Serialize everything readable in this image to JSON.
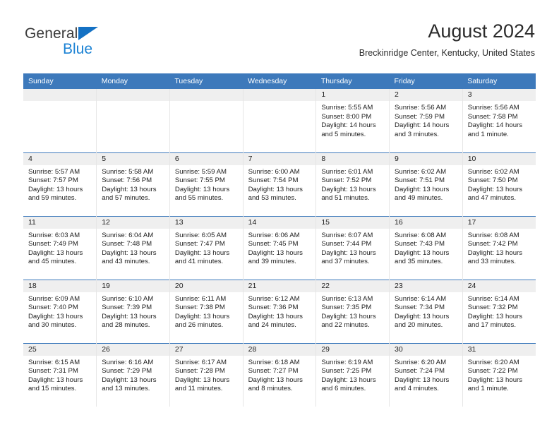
{
  "brand": {
    "name_part1": "General",
    "name_part2": "Blue",
    "triangle_color": "#1471c4",
    "blue_color": "#1b82d4"
  },
  "header": {
    "title": "August 2024",
    "subtitle": "Breckinridge Center, Kentucky, United States"
  },
  "theme": {
    "header_blue": "#3d79bb",
    "daynum_band": "#efefef",
    "text": "#1e1e1e"
  },
  "weekdays": [
    "Sunday",
    "Monday",
    "Tuesday",
    "Wednesday",
    "Thursday",
    "Friday",
    "Saturday"
  ],
  "weeks": [
    [
      {
        "day": "",
        "empty": true
      },
      {
        "day": "",
        "empty": true
      },
      {
        "day": "",
        "empty": true
      },
      {
        "day": "",
        "empty": true
      },
      {
        "day": "1",
        "sunrise": "Sunrise: 5:55 AM",
        "sunset": "Sunset: 8:00 PM",
        "daylight1": "Daylight: 14 hours",
        "daylight2": "and 5 minutes."
      },
      {
        "day": "2",
        "sunrise": "Sunrise: 5:56 AM",
        "sunset": "Sunset: 7:59 PM",
        "daylight1": "Daylight: 14 hours",
        "daylight2": "and 3 minutes."
      },
      {
        "day": "3",
        "sunrise": "Sunrise: 5:56 AM",
        "sunset": "Sunset: 7:58 PM",
        "daylight1": "Daylight: 14 hours",
        "daylight2": "and 1 minute."
      }
    ],
    [
      {
        "day": "4",
        "sunrise": "Sunrise: 5:57 AM",
        "sunset": "Sunset: 7:57 PM",
        "daylight1": "Daylight: 13 hours",
        "daylight2": "and 59 minutes."
      },
      {
        "day": "5",
        "sunrise": "Sunrise: 5:58 AM",
        "sunset": "Sunset: 7:56 PM",
        "daylight1": "Daylight: 13 hours",
        "daylight2": "and 57 minutes."
      },
      {
        "day": "6",
        "sunrise": "Sunrise: 5:59 AM",
        "sunset": "Sunset: 7:55 PM",
        "daylight1": "Daylight: 13 hours",
        "daylight2": "and 55 minutes."
      },
      {
        "day": "7",
        "sunrise": "Sunrise: 6:00 AM",
        "sunset": "Sunset: 7:54 PM",
        "daylight1": "Daylight: 13 hours",
        "daylight2": "and 53 minutes."
      },
      {
        "day": "8",
        "sunrise": "Sunrise: 6:01 AM",
        "sunset": "Sunset: 7:52 PM",
        "daylight1": "Daylight: 13 hours",
        "daylight2": "and 51 minutes."
      },
      {
        "day": "9",
        "sunrise": "Sunrise: 6:02 AM",
        "sunset": "Sunset: 7:51 PM",
        "daylight1": "Daylight: 13 hours",
        "daylight2": "and 49 minutes."
      },
      {
        "day": "10",
        "sunrise": "Sunrise: 6:02 AM",
        "sunset": "Sunset: 7:50 PM",
        "daylight1": "Daylight: 13 hours",
        "daylight2": "and 47 minutes."
      }
    ],
    [
      {
        "day": "11",
        "sunrise": "Sunrise: 6:03 AM",
        "sunset": "Sunset: 7:49 PM",
        "daylight1": "Daylight: 13 hours",
        "daylight2": "and 45 minutes."
      },
      {
        "day": "12",
        "sunrise": "Sunrise: 6:04 AM",
        "sunset": "Sunset: 7:48 PM",
        "daylight1": "Daylight: 13 hours",
        "daylight2": "and 43 minutes."
      },
      {
        "day": "13",
        "sunrise": "Sunrise: 6:05 AM",
        "sunset": "Sunset: 7:47 PM",
        "daylight1": "Daylight: 13 hours",
        "daylight2": "and 41 minutes."
      },
      {
        "day": "14",
        "sunrise": "Sunrise: 6:06 AM",
        "sunset": "Sunset: 7:45 PM",
        "daylight1": "Daylight: 13 hours",
        "daylight2": "and 39 minutes."
      },
      {
        "day": "15",
        "sunrise": "Sunrise: 6:07 AM",
        "sunset": "Sunset: 7:44 PM",
        "daylight1": "Daylight: 13 hours",
        "daylight2": "and 37 minutes."
      },
      {
        "day": "16",
        "sunrise": "Sunrise: 6:08 AM",
        "sunset": "Sunset: 7:43 PM",
        "daylight1": "Daylight: 13 hours",
        "daylight2": "and 35 minutes."
      },
      {
        "day": "17",
        "sunrise": "Sunrise: 6:08 AM",
        "sunset": "Sunset: 7:42 PM",
        "daylight1": "Daylight: 13 hours",
        "daylight2": "and 33 minutes."
      }
    ],
    [
      {
        "day": "18",
        "sunrise": "Sunrise: 6:09 AM",
        "sunset": "Sunset: 7:40 PM",
        "daylight1": "Daylight: 13 hours",
        "daylight2": "and 30 minutes."
      },
      {
        "day": "19",
        "sunrise": "Sunrise: 6:10 AM",
        "sunset": "Sunset: 7:39 PM",
        "daylight1": "Daylight: 13 hours",
        "daylight2": "and 28 minutes."
      },
      {
        "day": "20",
        "sunrise": "Sunrise: 6:11 AM",
        "sunset": "Sunset: 7:38 PM",
        "daylight1": "Daylight: 13 hours",
        "daylight2": "and 26 minutes."
      },
      {
        "day": "21",
        "sunrise": "Sunrise: 6:12 AM",
        "sunset": "Sunset: 7:36 PM",
        "daylight1": "Daylight: 13 hours",
        "daylight2": "and 24 minutes."
      },
      {
        "day": "22",
        "sunrise": "Sunrise: 6:13 AM",
        "sunset": "Sunset: 7:35 PM",
        "daylight1": "Daylight: 13 hours",
        "daylight2": "and 22 minutes."
      },
      {
        "day": "23",
        "sunrise": "Sunrise: 6:14 AM",
        "sunset": "Sunset: 7:34 PM",
        "daylight1": "Daylight: 13 hours",
        "daylight2": "and 20 minutes."
      },
      {
        "day": "24",
        "sunrise": "Sunrise: 6:14 AM",
        "sunset": "Sunset: 7:32 PM",
        "daylight1": "Daylight: 13 hours",
        "daylight2": "and 17 minutes."
      }
    ],
    [
      {
        "day": "25",
        "sunrise": "Sunrise: 6:15 AM",
        "sunset": "Sunset: 7:31 PM",
        "daylight1": "Daylight: 13 hours",
        "daylight2": "and 15 minutes."
      },
      {
        "day": "26",
        "sunrise": "Sunrise: 6:16 AM",
        "sunset": "Sunset: 7:29 PM",
        "daylight1": "Daylight: 13 hours",
        "daylight2": "and 13 minutes."
      },
      {
        "day": "27",
        "sunrise": "Sunrise: 6:17 AM",
        "sunset": "Sunset: 7:28 PM",
        "daylight1": "Daylight: 13 hours",
        "daylight2": "and 11 minutes."
      },
      {
        "day": "28",
        "sunrise": "Sunrise: 6:18 AM",
        "sunset": "Sunset: 7:27 PM",
        "daylight1": "Daylight: 13 hours",
        "daylight2": "and 8 minutes."
      },
      {
        "day": "29",
        "sunrise": "Sunrise: 6:19 AM",
        "sunset": "Sunset: 7:25 PM",
        "daylight1": "Daylight: 13 hours",
        "daylight2": "and 6 minutes."
      },
      {
        "day": "30",
        "sunrise": "Sunrise: 6:20 AM",
        "sunset": "Sunset: 7:24 PM",
        "daylight1": "Daylight: 13 hours",
        "daylight2": "and 4 minutes."
      },
      {
        "day": "31",
        "sunrise": "Sunrise: 6:20 AM",
        "sunset": "Sunset: 7:22 PM",
        "daylight1": "Daylight: 13 hours",
        "daylight2": "and 1 minute."
      }
    ]
  ]
}
